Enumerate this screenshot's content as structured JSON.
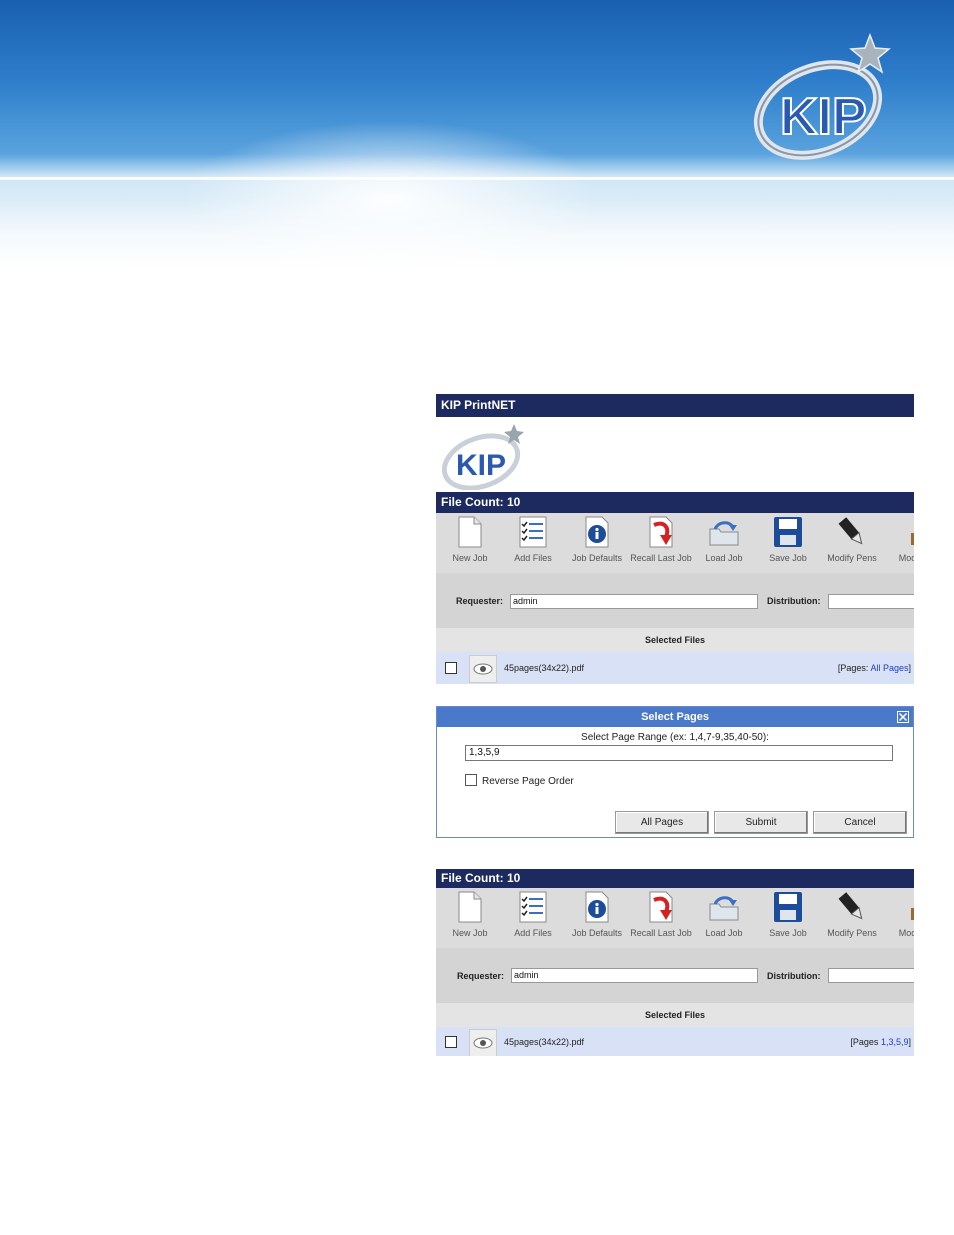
{
  "banner": {
    "logo_text": "KIP"
  },
  "panel1": {
    "app_title": "KIP PrintNET",
    "logo_text": "KIP",
    "file_count": "File Count: 10",
    "toolbar": [
      "New Job",
      "Add Files",
      "Job Defaults",
      "Recall Last Job",
      "Load Job",
      "Save Job",
      "Modify Pens",
      "Modify"
    ],
    "requester_label": "Requester:",
    "requester_value": "admin",
    "distribution_label": "Distribution:",
    "distribution_value": "",
    "selected_files": "Selected Files",
    "file_name": "45pages(34x22).pdf",
    "pages_prefix": "[Pages:",
    "pages_value": "All Pages",
    "pages_suffix": "]"
  },
  "dialog": {
    "title": "Select Pages",
    "prompt": "Select Page Range (ex: 1,4,7-9,35,40-50):",
    "range_value": "1,3,5,9",
    "reverse_label": "Reverse Page Order",
    "btn_all": "All Pages",
    "btn_submit": "Submit",
    "btn_cancel": "Cancel"
  },
  "panel2": {
    "file_count": "File Count: 10",
    "toolbar": [
      "New Job",
      "Add Files",
      "Job Defaults",
      "Recall Last Job",
      "Load Job",
      "Save Job",
      "Modify Pens",
      "Modify"
    ],
    "requester_label": "Requester:",
    "requester_value": "admin",
    "distribution_label": "Distribution:",
    "distribution_value": "",
    "selected_files": "Selected Files",
    "file_name": "45pages(34x22).pdf",
    "pages_prefix": "[Pages",
    "pages_value": "1,3,5,9",
    "pages_suffix": "]"
  },
  "colors": {
    "title_bar": "#1c2a60",
    "dialog_title": "#4a79c9",
    "file_row": "#d9e1f7",
    "link": "#1b3fc9"
  },
  "icons": [
    "new-job-icon",
    "add-files-icon",
    "job-defaults-icon",
    "recall-last-job-icon",
    "load-job-icon",
    "save-job-icon",
    "modify-pens-icon",
    "modify-icon",
    "eye-preview-icon",
    "close-icon",
    "kip-logo"
  ]
}
